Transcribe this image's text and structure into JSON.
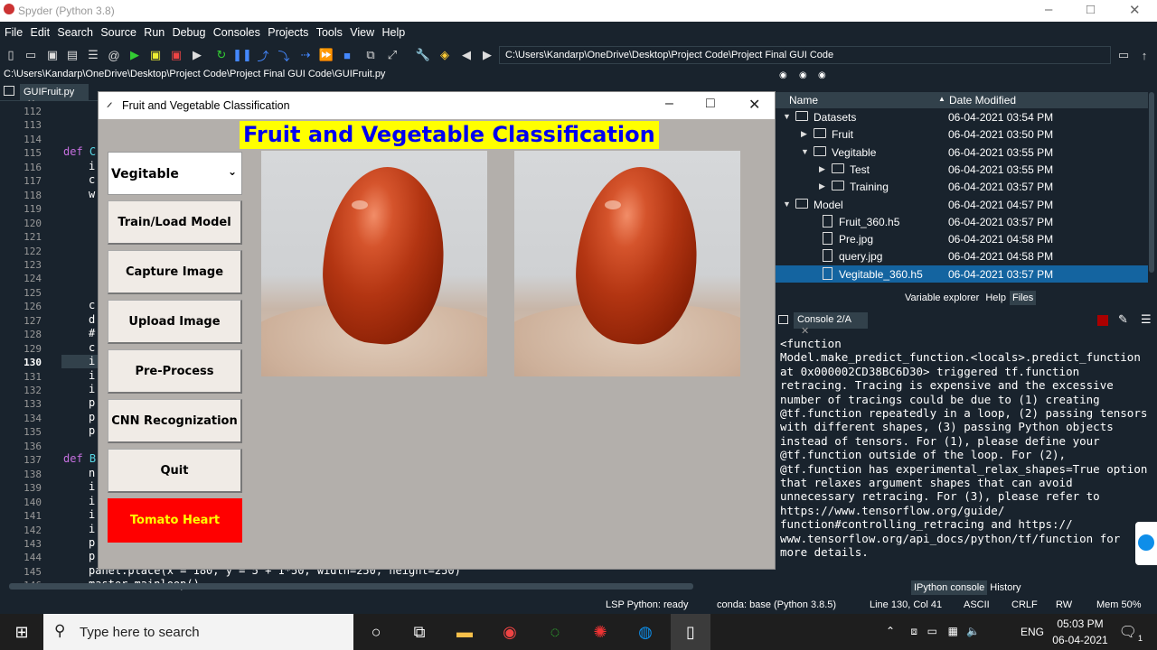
{
  "app": {
    "title": "Spyder (Python 3.8)",
    "window_controls": {
      "minimize": "–",
      "maximize": "□",
      "close": "✕"
    }
  },
  "menu": [
    "File",
    "Edit",
    "Search",
    "Source",
    "Run",
    "Debug",
    "Consoles",
    "Projects",
    "Tools",
    "View",
    "Help"
  ],
  "toolbar": {
    "working_dir": "C:\\Users\\Kandarp\\OneDrive\\Desktop\\Project Code\\Project Final GUI Code"
  },
  "editor": {
    "file_path": "C:\\Users\\Kandarp\\OneDrive\\Desktop\\Project Code\\Project Final GUI Code\\GUIFruit.py",
    "tab_label": "GUIFruit.py",
    "line_numbers": [
      "112",
      "113",
      "114",
      "115",
      "116",
      "117",
      "118",
      "119",
      "120",
      "121",
      "122",
      "123",
      "124",
      "125",
      "126",
      "127",
      "128",
      "129",
      "130",
      "131",
      "132",
      "133",
      "134",
      "135",
      "136",
      "137",
      "138",
      "139",
      "140",
      "141",
      "142",
      "143",
      "144",
      "145",
      "146"
    ],
    "current_line": "130",
    "code": {
      "l115_def": "def",
      "l115_fn": "C",
      "l137_def": "def",
      "l137_fn": "B",
      "l145": "panel.place(x = 180, y = 5 + 1*50, width=250, height=250)",
      "l146": "master.mainloop()",
      "fragments": {
        "116": "i",
        "117": "c",
        "118": "w",
        "126": "c",
        "127": "d",
        "128": "#",
        "129": "c",
        "130": "i",
        "131": "i",
        "132": "i",
        "133": "p",
        "134": "p",
        "135": "p",
        "138": "n",
        "139": "i",
        "140": "i",
        "141": "i",
        "142": "i",
        "143": "p",
        "144": "p"
      }
    }
  },
  "file_explorer": {
    "columns": [
      "Name",
      "Date Modified"
    ],
    "rows": [
      {
        "name": "Datasets",
        "date": "06-04-2021 03:54 PM",
        "type": "folder",
        "expanded": true,
        "depth": 0
      },
      {
        "name": "Fruit",
        "date": "06-04-2021 03:50 PM",
        "type": "folder",
        "expanded": false,
        "depth": 1
      },
      {
        "name": "Vegitable",
        "date": "06-04-2021 03:55 PM",
        "type": "folder",
        "expanded": true,
        "depth": 1
      },
      {
        "name": "Test",
        "date": "06-04-2021 03:55 PM",
        "type": "folder",
        "expanded": false,
        "depth": 2
      },
      {
        "name": "Training",
        "date": "06-04-2021 03:57 PM",
        "type": "folder",
        "expanded": false,
        "depth": 2
      },
      {
        "name": "Model",
        "date": "06-04-2021 04:57 PM",
        "type": "folder",
        "expanded": true,
        "depth": 0
      },
      {
        "name": "Fruit_360.h5",
        "date": "06-04-2021 03:57 PM",
        "type": "file",
        "depth": 1
      },
      {
        "name": "Pre.jpg",
        "date": "06-04-2021 04:58 PM",
        "type": "file",
        "depth": 1
      },
      {
        "name": "query.jpg",
        "date": "06-04-2021 04:58 PM",
        "type": "file",
        "depth": 1
      },
      {
        "name": "Vegitable_360.h5",
        "date": "06-04-2021 03:57 PM",
        "type": "file",
        "depth": 1,
        "selected": true
      }
    ],
    "pane_tabs": [
      "Variable explorer",
      "Help",
      "Files"
    ],
    "active_tab": "Files"
  },
  "console": {
    "tab_label": "Console 2/A",
    "output": "<function\nModel.make_predict_function.<locals>.predict_function\nat 0x000002CD38BC6D30> triggered tf.function\nretracing. Tracing is expensive and the excessive\nnumber of tracings could be due to (1) creating\n@tf.function repeatedly in a loop, (2) passing tensors\nwith different shapes, (3) passing Python objects\ninstead of tensors. For (1), please define your\n@tf.function outside of the loop. For (2),\n@tf.function has experimental_relax_shapes=True option\nthat relaxes argument shapes that can avoid\nunnecessary retracing. For (3), please refer to\nhttps://www.tensorflow.org/guide/\nfunction#controlling_retracing and https://\nwww.tensorflow.org/api_docs/python/tf/function for\nmore details.",
    "bottom_tabs": [
      "IPython console",
      "History"
    ],
    "active_tab": "IPython console"
  },
  "statusbar": {
    "lsp": "LSP Python: ready",
    "conda": "conda: base (Python 3.8.5)",
    "position": "Line 130, Col 41",
    "encoding": "ASCII",
    "eol": "CRLF",
    "rw": "RW",
    "mem": "Mem 50%"
  },
  "tk_app": {
    "window_title": "Fruit and Vegetable Classification",
    "heading": "Fruit and Vegetable Classification",
    "category_select": "Vegitable",
    "buttons": [
      "Train/Load Model",
      "Capture Image",
      "Upload Image",
      "Pre-Process",
      "CNN Recognization",
      "Quit"
    ],
    "result": "Tomato Heart",
    "colors": {
      "heading_bg": "#ffff00",
      "heading_fg": "#0000ee",
      "result_bg": "#ff0000",
      "result_fg": "#ffff00",
      "window_bg": "#b3afab"
    }
  },
  "taskbar": {
    "search_placeholder": "Type here to search",
    "language": "ENG",
    "time": "05:03 PM",
    "date": "06-04-2021",
    "notification_count": "1"
  }
}
